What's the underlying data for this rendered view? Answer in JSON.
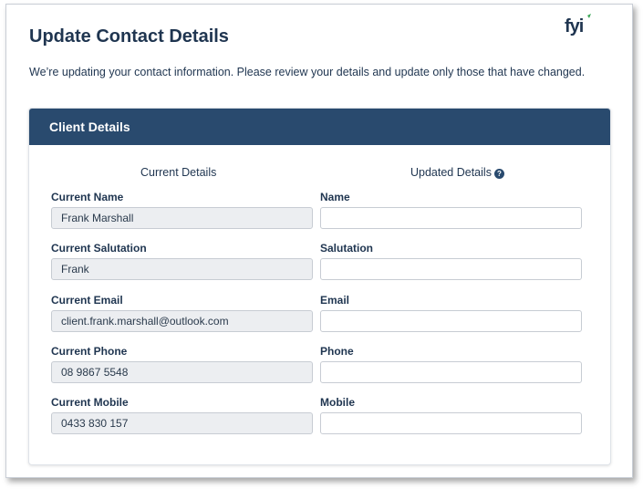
{
  "page": {
    "title": "Update Contact Details",
    "intro": "We’re updating your contact information. Please review your details and update only those that have changed.",
    "logo_text": "fyi"
  },
  "card": {
    "header": "Client Details",
    "current_heading": "Current Details",
    "updated_heading": "Updated Details",
    "help_icon": "?"
  },
  "fields": [
    {
      "current_label": "Current Name",
      "current_value": "Frank Marshall",
      "updated_label": "Name",
      "updated_value": ""
    },
    {
      "current_label": "Current Salutation",
      "current_value": "Frank",
      "updated_label": "Salutation",
      "updated_value": ""
    },
    {
      "current_label": "Current Email",
      "current_value": "client.frank.marshall@outlook.com",
      "updated_label": "Email",
      "updated_value": ""
    },
    {
      "current_label": "Current Phone",
      "current_value": "08 9867 5548",
      "updated_label": "Phone",
      "updated_value": ""
    },
    {
      "current_label": "Current Mobile",
      "current_value": "0433 830 157",
      "updated_label": "Mobile",
      "updated_value": ""
    }
  ],
  "colors": {
    "brand": "#294a6e",
    "text": "#1f3550",
    "readonly_bg": "#eceef1",
    "logo_accent": "#3aa655"
  },
  "icons": {
    "logo": "fyi-logo",
    "help": "help-circle-icon"
  }
}
